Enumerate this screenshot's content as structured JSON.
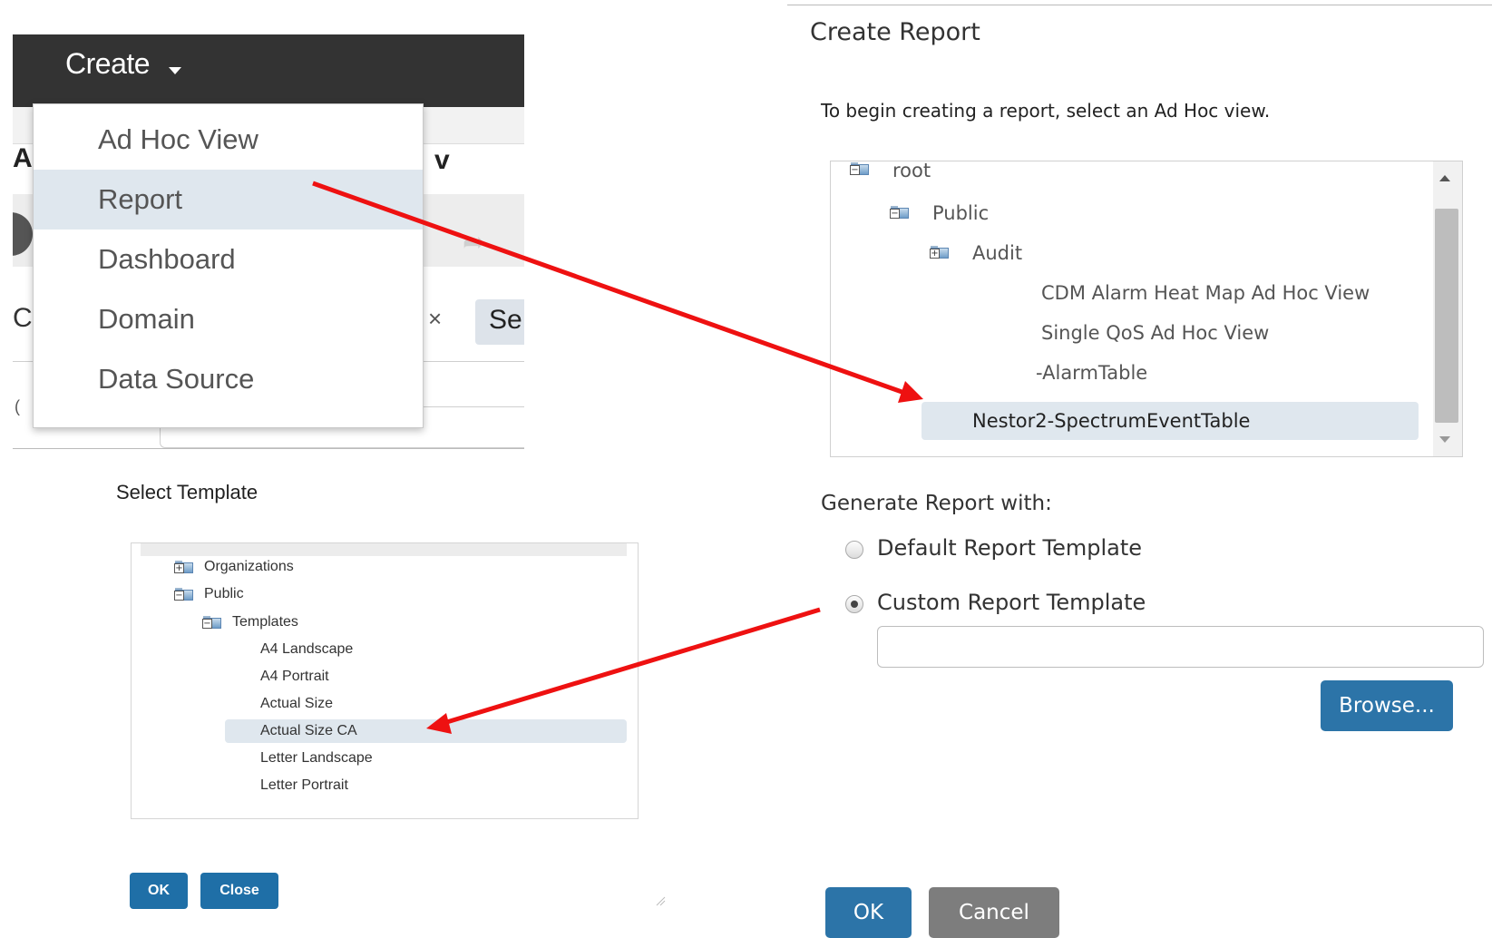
{
  "create_menu": {
    "button_label": "Create",
    "items": [
      {
        "label": "Ad Hoc View",
        "selected": false
      },
      {
        "label": "Report",
        "selected": true
      },
      {
        "label": "Dashboard",
        "selected": false
      },
      {
        "label": "Domain",
        "selected": false
      },
      {
        "label": "Data Source",
        "selected": false
      }
    ],
    "background_fragments": {
      "a": "A",
      "v": "v",
      "c": "C",
      "se": "Se",
      "x": "×",
      "dot": "("
    }
  },
  "select_template": {
    "title": "Select Template",
    "tree": [
      {
        "label": "Organizations",
        "type": "folder",
        "expanded": false
      },
      {
        "label": "Public",
        "type": "folder",
        "expanded": true
      },
      {
        "label": "Templates",
        "type": "folder",
        "expanded": true
      },
      {
        "label": "A4 Landscape",
        "type": "leaf"
      },
      {
        "label": "A4 Portrait",
        "type": "leaf"
      },
      {
        "label": "Actual Size",
        "type": "leaf"
      },
      {
        "label": "Actual Size CA",
        "type": "leaf",
        "selected": true
      },
      {
        "label": "Letter Landscape",
        "type": "leaf"
      },
      {
        "label": "Letter Portrait",
        "type": "leaf"
      }
    ],
    "ok_label": "OK",
    "close_label": "Close"
  },
  "create_report": {
    "title": "Create Report",
    "instructions": "To begin creating a report, select an Ad Hoc view.",
    "tree": [
      {
        "label": "root",
        "type": "folder",
        "expanded": true
      },
      {
        "label": "Public",
        "type": "folder",
        "expanded": true
      },
      {
        "label": "Audit",
        "type": "folder",
        "expanded": false
      },
      {
        "label": "CDM Alarm Heat Map Ad Hoc View",
        "type": "leaf"
      },
      {
        "label": "Single QoS Ad Hoc View",
        "type": "leaf"
      },
      {
        "label": "-AlarmTable",
        "type": "leaf"
      },
      {
        "label": "Nestor2-SpectrumEventTable",
        "type": "leaf",
        "selected": true
      }
    ],
    "generate_label": "Generate Report with:",
    "radio_options": [
      {
        "label": "Default Report Template",
        "checked": false
      },
      {
        "label": "Custom Report Template",
        "checked": true
      }
    ],
    "template_input_value": "",
    "browse_label": "Browse...",
    "ok_label": "OK",
    "cancel_label": "Cancel"
  },
  "colors": {
    "menu_bar": "#333333",
    "selection": "#dfe7ee",
    "primary_button": "#2c74a8",
    "cancel_button": "#7d7d7d",
    "annotation_arrow": "#ee1111"
  }
}
